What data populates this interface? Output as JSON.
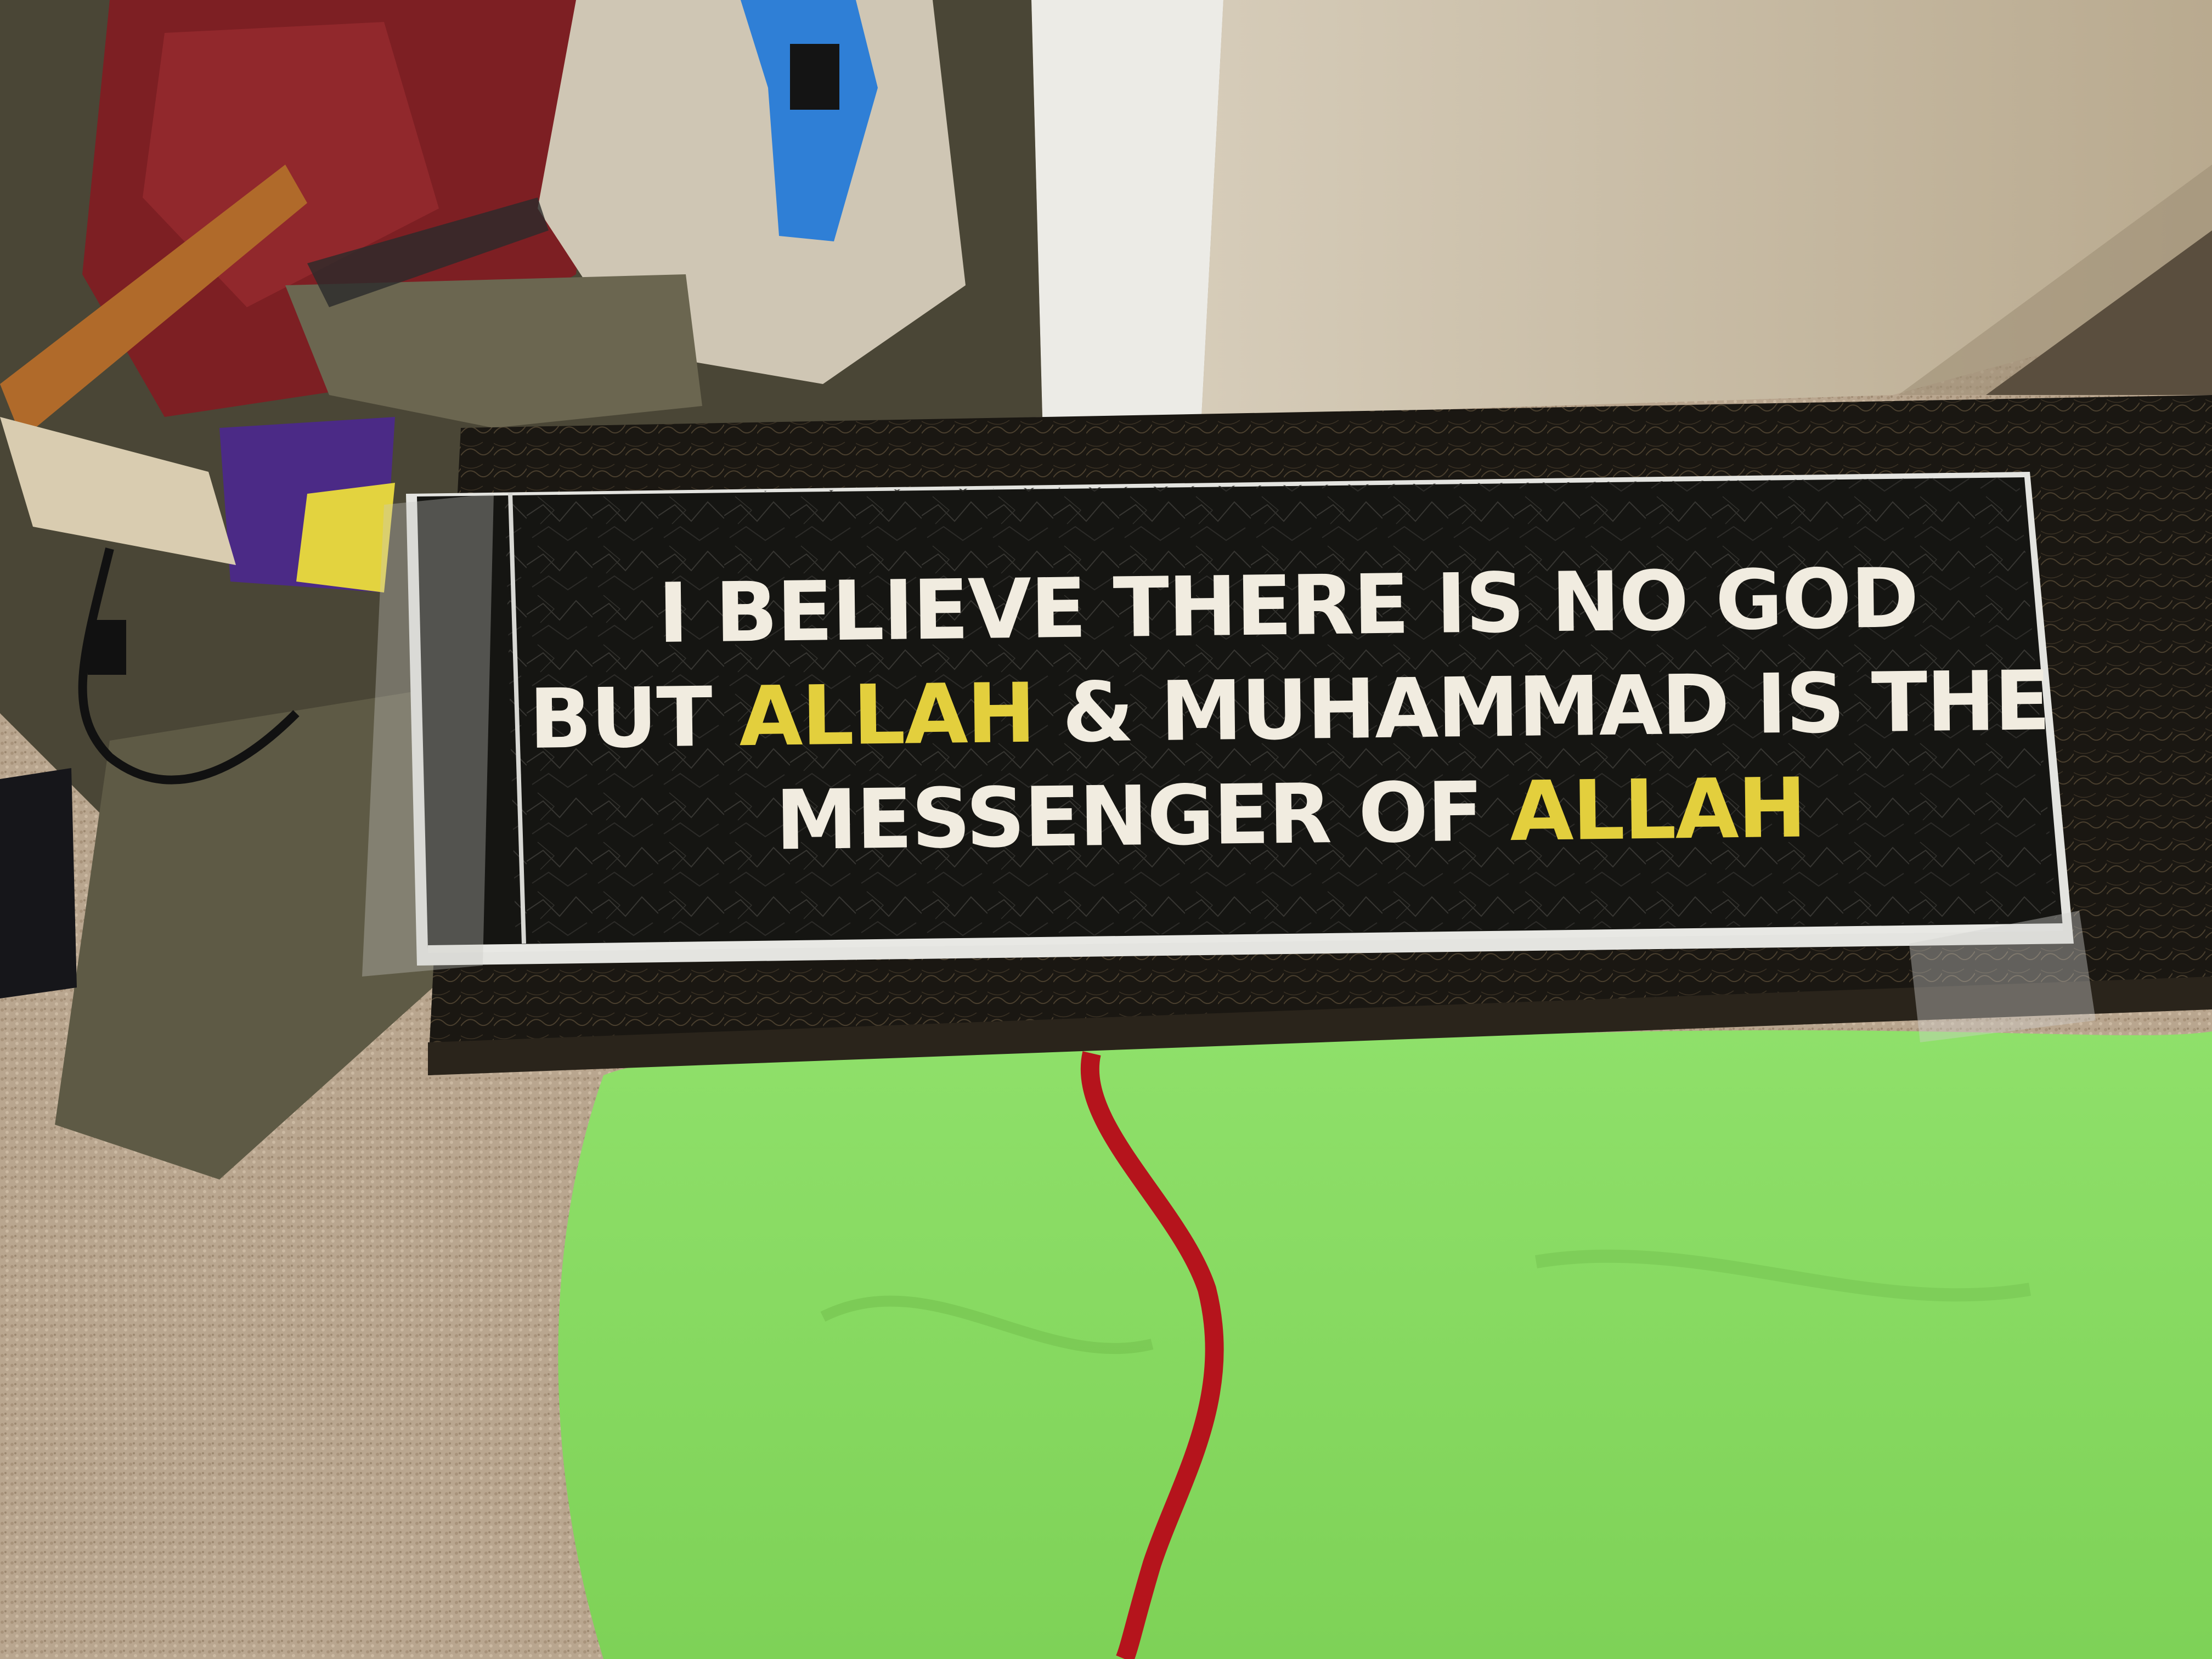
{
  "sticker": {
    "line1": "I BELIEVE THERE IS NO GOD",
    "line2_a": "BUT",
    "line2_b": "ALLAH",
    "line2_c": "& MUHAMMAD IS THE",
    "line3_a": "MESSENGER OF",
    "line3_b": "ALLAH",
    "text_color": "#f1ece0",
    "highlight_color": "#e3cf3d",
    "background_color": "#151512"
  },
  "scene": {
    "objects": [
      "carpet",
      "wardrobe-door",
      "clothes-pile",
      "power-cord",
      "marble-shelf",
      "green-blanket",
      "red-cord"
    ]
  }
}
